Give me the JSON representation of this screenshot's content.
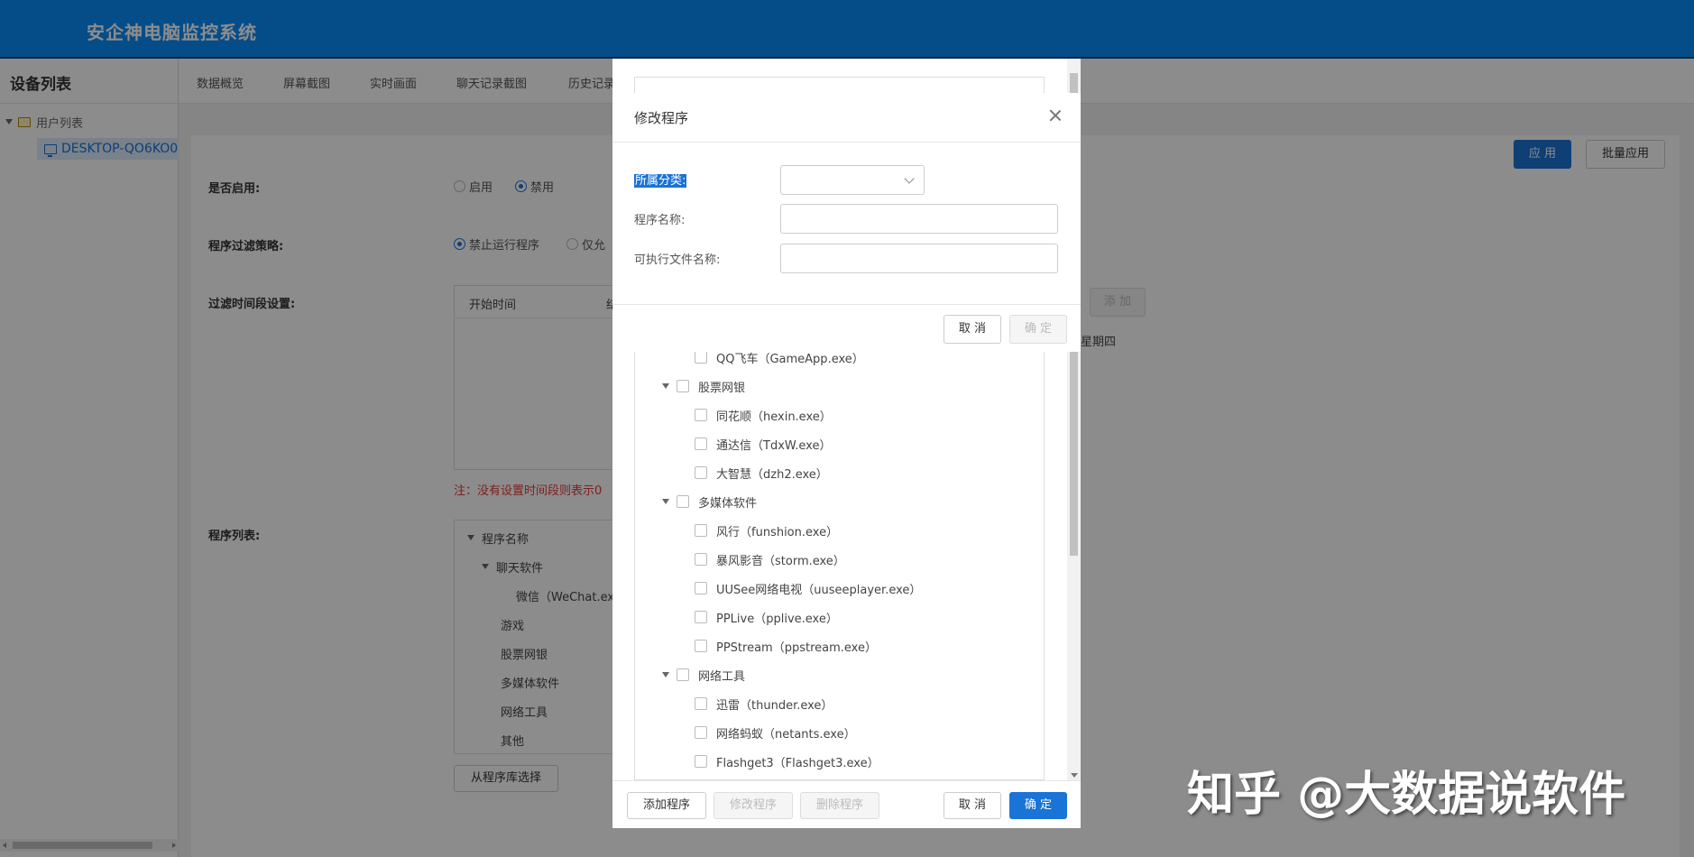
{
  "app": {
    "title": "安企神电脑监控系统"
  },
  "sidebar": {
    "heading": "设备列表",
    "root_label": "用户列表",
    "device_label": "DESKTOP-QO6KO0"
  },
  "tabs": [
    "数据概览",
    "屏幕截图",
    "实时画面",
    "聊天记录截图",
    "历史记录"
  ],
  "toolbar": {
    "apply_label": "应 用",
    "batch_apply_label": "批量应用"
  },
  "form": {
    "enabled_label": "是否启用:",
    "enable_option": "启用",
    "disable_option": "禁用",
    "policy_label": "程序过滤策略:",
    "policy_option1": "禁止运行程序",
    "policy_option2": "仅允",
    "time_label": "过滤时间段设置:",
    "time_col_start": "开始时间",
    "time_col_end": "结",
    "time_add_label": "添 加",
    "weekday_fragment": "星期四",
    "note": "注：没有设置时间段则表示0",
    "program_list_label": "程序列表:",
    "select_from_lib_label": "从程序库选择"
  },
  "program_tree": [
    {
      "label": "程序名称"
    },
    {
      "label": "聊天软件"
    },
    {
      "label": "微信（WeChat.ex"
    },
    {
      "label": "游戏"
    },
    {
      "label": "股票网银"
    },
    {
      "label": "多媒体软件"
    },
    {
      "label": "网络工具"
    },
    {
      "label": "其他"
    }
  ],
  "library_dialog": {
    "rows": [
      {
        "label": "QQ飞车（GameApp.exe）",
        "type": "item"
      },
      {
        "label": "股票网银",
        "type": "group"
      },
      {
        "label": "同花顺（hexin.exe）",
        "type": "item"
      },
      {
        "label": "通达信（TdxW.exe）",
        "type": "item"
      },
      {
        "label": "大智慧（dzh2.exe）",
        "type": "item"
      },
      {
        "label": "多媒体软件",
        "type": "group"
      },
      {
        "label": "风行（funshion.exe）",
        "type": "item"
      },
      {
        "label": "暴风影音（storm.exe）",
        "type": "item"
      },
      {
        "label": "UUSee网络电视（uuseeplayer.exe）",
        "type": "item"
      },
      {
        "label": "PPLive（pplive.exe）",
        "type": "item"
      },
      {
        "label": "PPStream（ppstream.exe）",
        "type": "item"
      },
      {
        "label": "网络工具",
        "type": "group"
      },
      {
        "label": "迅雷（thunder.exe）",
        "type": "item"
      },
      {
        "label": "网络蚂蚁（netants.exe）",
        "type": "item"
      },
      {
        "label": "Flashget3（Flashget3.exe）",
        "type": "item"
      }
    ],
    "add_label": "添加程序",
    "edit_label": "修改程序",
    "delete_label": "删除程序",
    "cancel_label": "取 消",
    "ok_label": "确 定"
  },
  "edit_dialog": {
    "title": "修改程序",
    "category_label": "所属分类:",
    "category_value": "",
    "name_label": "程序名称:",
    "name_value": "",
    "exe_label": "可执行文件名称:",
    "exe_value": "",
    "cancel_label": "取 消",
    "ok_label": "确 定"
  },
  "watermark": "知乎 @大数据说软件",
  "colors": {
    "topbar": "#0a8cf7",
    "primary": "#1a73d6",
    "note": "#e53935"
  }
}
